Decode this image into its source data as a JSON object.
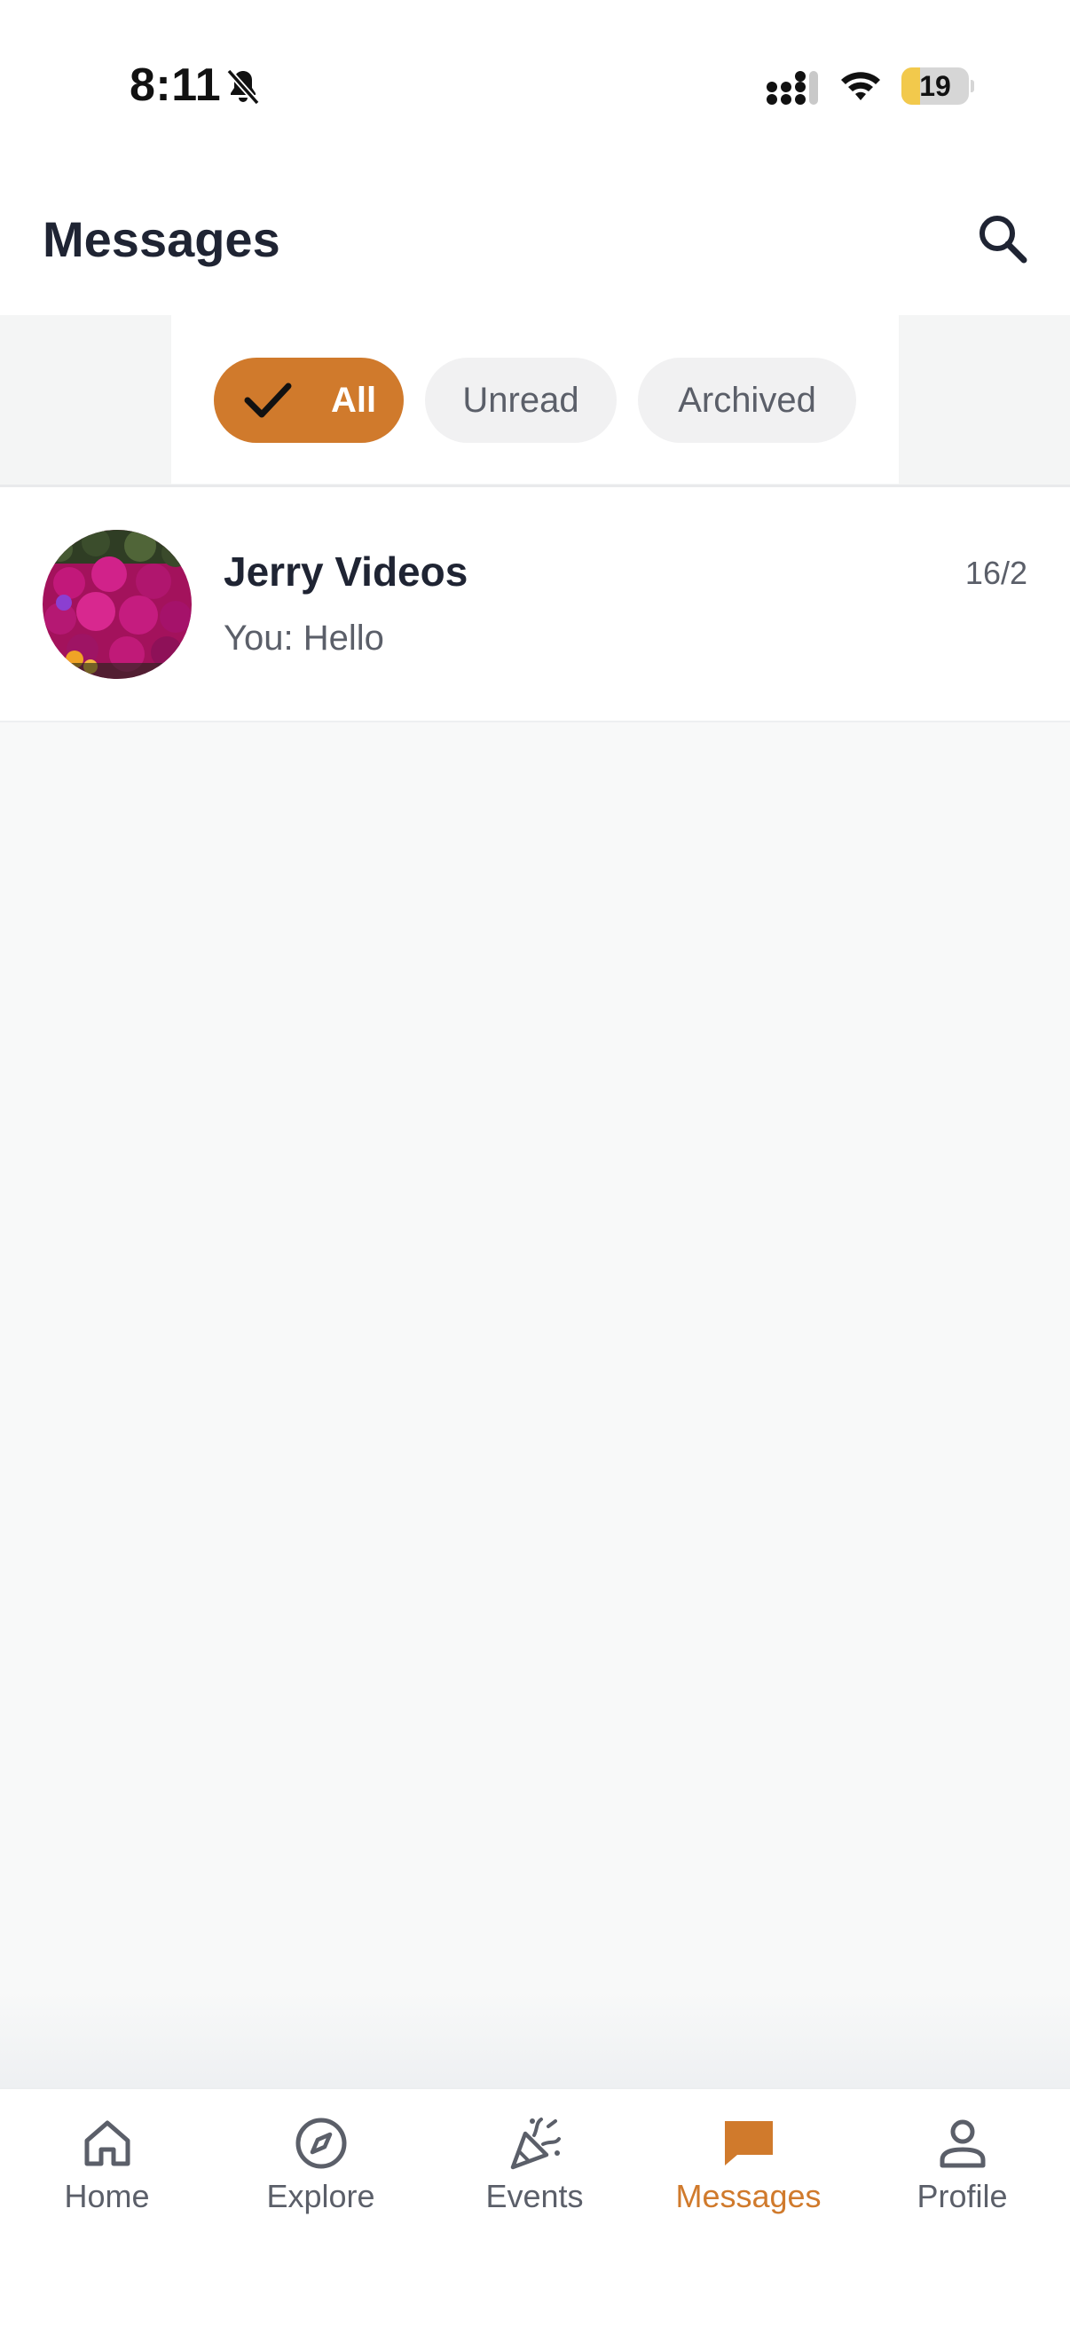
{
  "status_bar": {
    "time": "8:11",
    "battery_level": "19",
    "battery_fraction": 0.19,
    "icons": [
      "bell-slash-icon",
      "cellular-signal-icon",
      "wifi-icon",
      "battery-icon"
    ]
  },
  "header": {
    "title": "Messages",
    "search_icon": "search-icon"
  },
  "filters": {
    "items": [
      {
        "label": "All",
        "selected": true,
        "icon": "check-icon"
      },
      {
        "label": "Unread",
        "selected": false
      },
      {
        "label": "Archived",
        "selected": false
      }
    ]
  },
  "conversations": [
    {
      "name": "Jerry Videos",
      "last_message": "You: Hello",
      "date": "16/2",
      "avatar": "flower-photo-avatar"
    }
  ],
  "bottom_nav": {
    "items": [
      {
        "label": "Home",
        "icon": "home-icon",
        "active": false
      },
      {
        "label": "Explore",
        "icon": "compass-icon",
        "active": false
      },
      {
        "label": "Events",
        "icon": "party-popper-icon",
        "active": false
      },
      {
        "label": "Messages",
        "icon": "chat-bubble-icon",
        "active": true
      },
      {
        "label": "Profile",
        "icon": "person-icon",
        "active": false
      }
    ]
  },
  "colors": {
    "accent": "#d07a2c",
    "text_primary": "#1f2433",
    "text_secondary": "#5b5f69",
    "background": "#f8f9f9",
    "chip_background": "#f1f1f2"
  }
}
